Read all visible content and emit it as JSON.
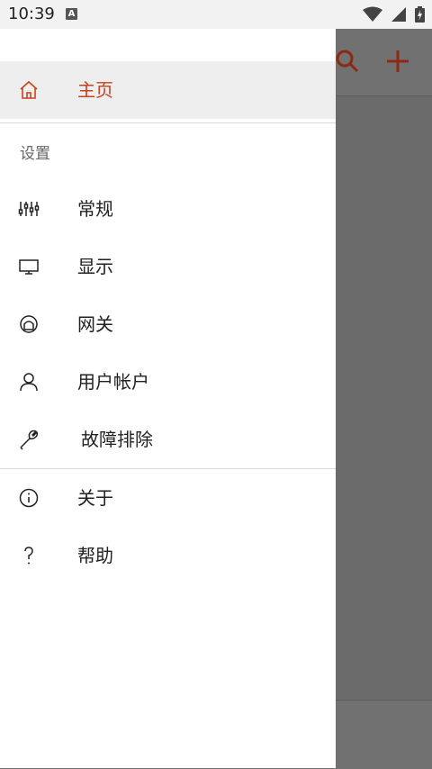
{
  "status_bar": {
    "time": "10:39",
    "notification_badge": "A",
    "icons": [
      "wifi-icon",
      "signal-icon",
      "battery-charging-icon"
    ]
  },
  "background_app": {
    "toolbar_icons": [
      "search-icon",
      "add-icon"
    ],
    "accent_color": "#8a2a12"
  },
  "drawer": {
    "home": {
      "label": "主页",
      "icon": "home-icon",
      "selected": true
    },
    "settings_section": {
      "header": "设置",
      "items": [
        {
          "label": "常规",
          "icon": "sliders-icon"
        },
        {
          "label": "显示",
          "icon": "monitor-icon"
        },
        {
          "label": "网关",
          "icon": "gateway-icon"
        },
        {
          "label": "用户帐户",
          "icon": "user-icon"
        },
        {
          "label": "故障排除",
          "icon": "wrench-icon"
        }
      ]
    },
    "footer_items": [
      {
        "label": "关于",
        "icon": "info-icon"
      },
      {
        "label": "帮助",
        "icon": "help-icon"
      }
    ]
  },
  "colors": {
    "accent": "#c8411f",
    "scrim": "#6b6b6b",
    "selected_background": "#eeeeee"
  }
}
